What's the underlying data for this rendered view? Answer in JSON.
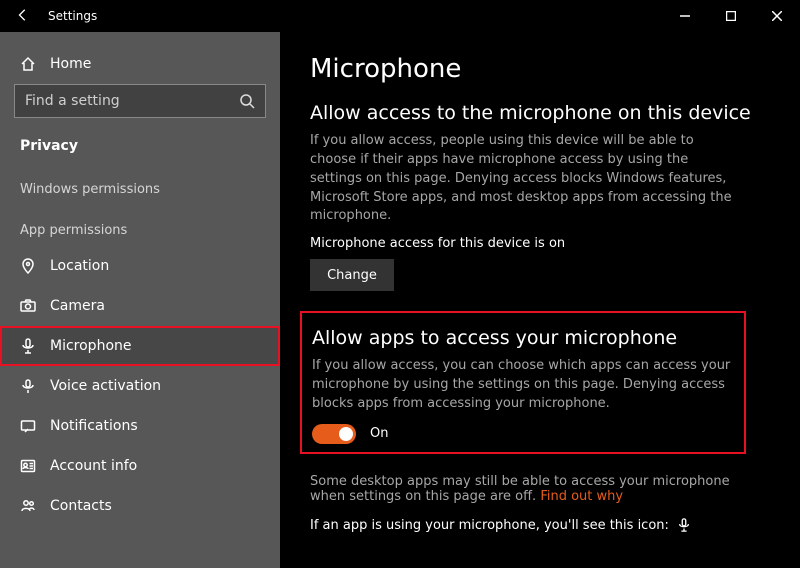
{
  "window": {
    "title": "Settings"
  },
  "sidebar": {
    "home_label": "Home",
    "search_placeholder": "Find a setting",
    "category_label": "Privacy",
    "group1_label": "Windows permissions",
    "group2_label": "App permissions",
    "items": [
      {
        "label": "Location"
      },
      {
        "label": "Camera"
      },
      {
        "label": "Microphone"
      },
      {
        "label": "Voice activation"
      },
      {
        "label": "Notifications"
      },
      {
        "label": "Account info"
      },
      {
        "label": "Contacts"
      }
    ]
  },
  "main": {
    "title": "Microphone",
    "sec1": {
      "heading": "Allow access to the microphone on this device",
      "body": "If you allow access, people using this device will be able to choose if their apps have microphone access by using the settings on this page. Denying access blocks Windows features, Microsoft Store apps, and most desktop apps from accessing the microphone.",
      "status": "Microphone access for this device is on",
      "button": "Change"
    },
    "sec2": {
      "heading": "Allow apps to access your microphone",
      "body": "If you allow access, you can choose which apps can access your microphone by using the settings on this page. Denying access blocks apps from accessing your microphone.",
      "toggle_label": "On"
    },
    "note": {
      "text": "Some desktop apps may still be able to access your microphone when settings on this page are off. ",
      "link": "Find out why"
    },
    "iconline": "If an app is using your microphone, you'll see this icon:"
  }
}
